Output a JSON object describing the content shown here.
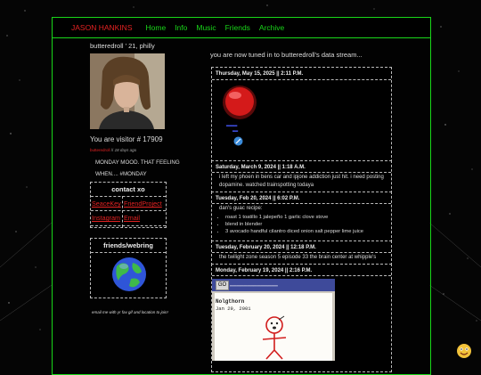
{
  "nav": {
    "site_title": "JASON HANKINS",
    "links": [
      "Home",
      "Info",
      "Music",
      "Friends",
      "Archive"
    ]
  },
  "profile": {
    "name_line": "butteredroll ' 21, philly",
    "visitor_text": "You are visitor # 17909",
    "mood_user": "butteredroll",
    "mood_ago": "18 days ago",
    "mood_line1": "MONDAY MOOD. THAT FEELING",
    "mood_line2": "WHEN.... #MONDAY"
  },
  "contact": {
    "header": "contact xo",
    "links": [
      "SeaceKey",
      "FriendProject",
      "Instagram",
      "Email"
    ]
  },
  "webring": {
    "header": "friends/webring"
  },
  "email_note": "email me with yr fav gif and location to join!",
  "feed": {
    "intro": "you are now tuned in to butteredroll's data stream...",
    "posts": [
      {
        "date": "Thursday, May 15, 2025 || 2:11 P.M."
      },
      {
        "date": "Saturday, March 9, 2024 || 1:18 A.M.",
        "text": "i left my phoen in bens car and ipjone addiction just hit. i need posting dopamine. watched trainspotting todaya"
      },
      {
        "date": "Tuesday, Feb 20, 2024 || 6:02 P.M.",
        "text": "dan's guac recipe:",
        "list": [
          "roast 1 toatillo 1 jalepeño 1 garlic clove stove",
          "blend in blender",
          "3 avocado handful cilantro diced onion salt pepper lime juice"
        ]
      },
      {
        "date": "Tuesday, February 20, 2024 || 12:18 P.M.",
        "text": "the twilight zone season 5 episode 33 the brain center at whipple's"
      },
      {
        "date": "Monday, February 19, 2024 || 2:16 P.M."
      }
    ],
    "window": {
      "button": "GO",
      "author": "Nolgthorn",
      "date": "Jan 29, 2001"
    }
  },
  "colors": {
    "accent_green": "#19d619",
    "accent_red": "#e52222",
    "background": "#050505"
  },
  "icons": {
    "button": "red-button-icon",
    "link": "link-icon",
    "globe": "globe-icon",
    "corner": "smiley-icon"
  }
}
